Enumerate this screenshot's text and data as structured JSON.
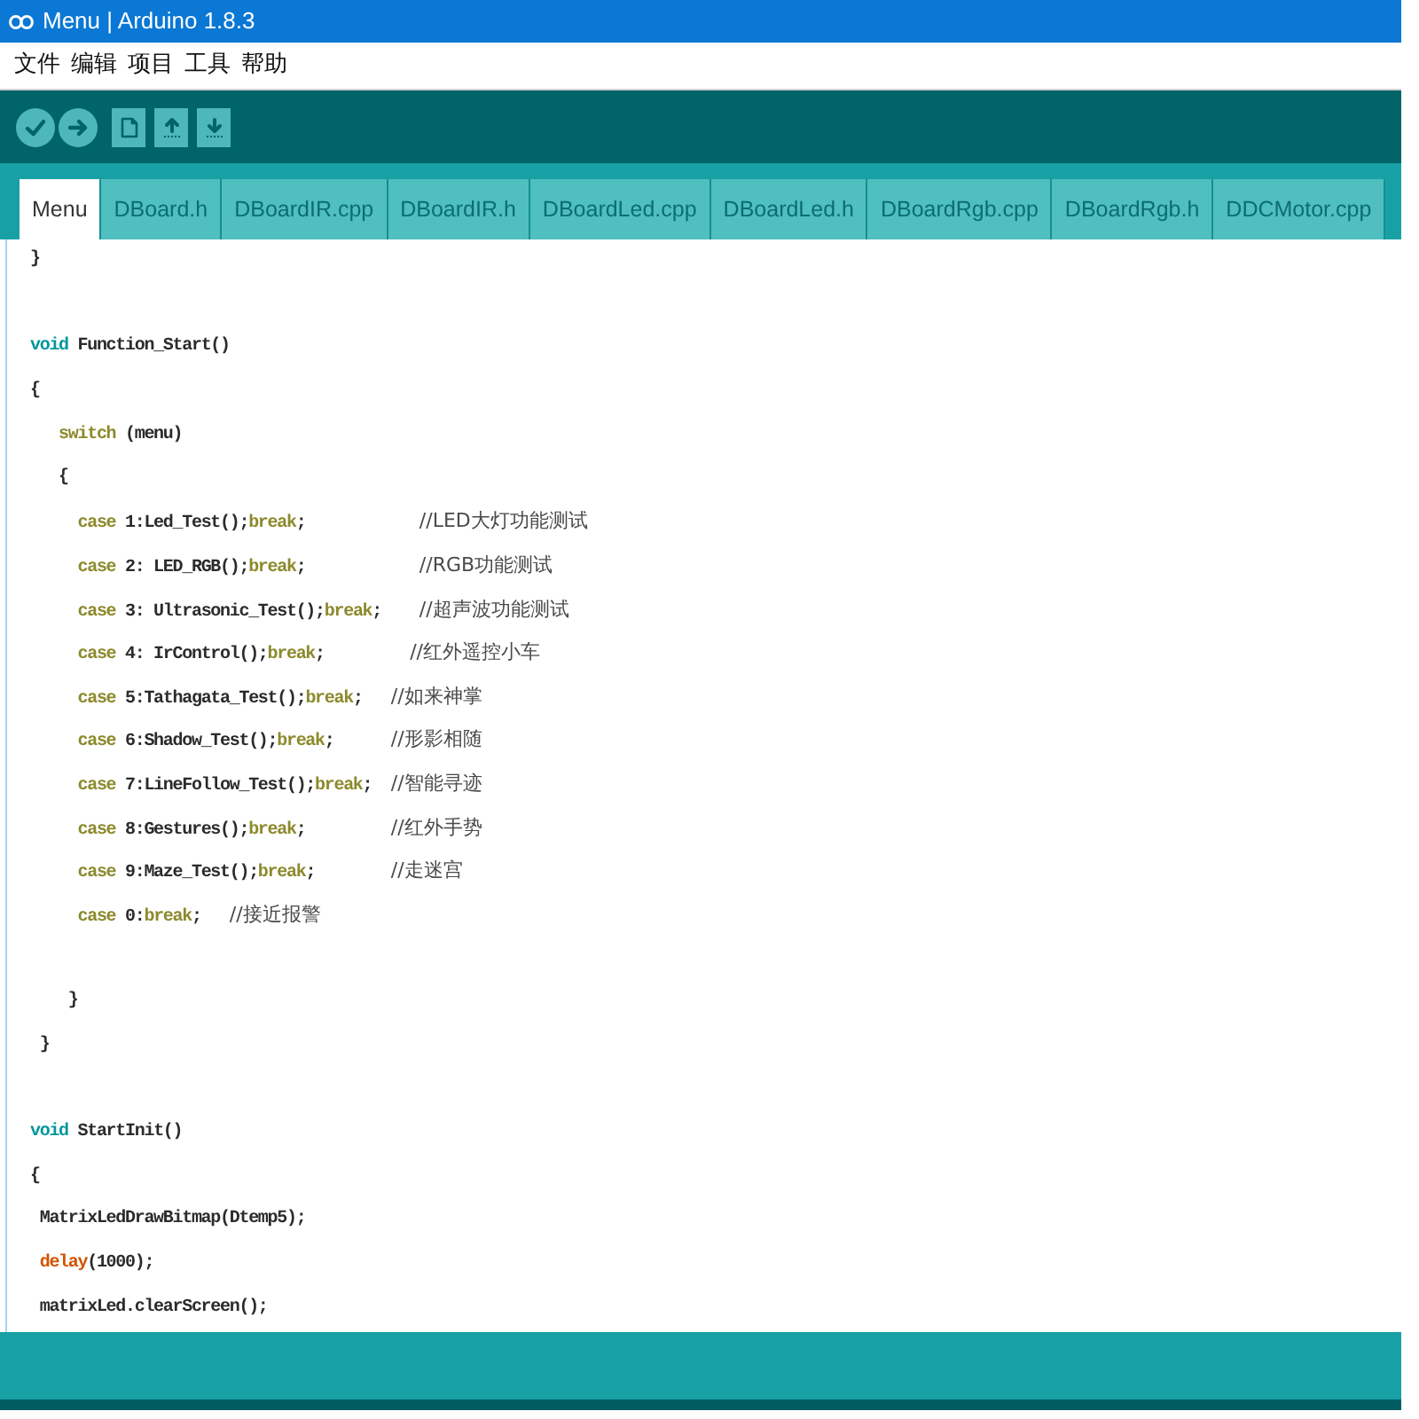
{
  "window": {
    "title": "Menu | Arduino 1.8.3"
  },
  "menu_bar": {
    "items": [
      "文件",
      "编辑",
      "项目",
      "工具",
      "帮助"
    ]
  },
  "tabs": [
    {
      "label": "Menu",
      "selected": true
    },
    {
      "label": "DBoard.h",
      "selected": false
    },
    {
      "label": "DBoardIR.cpp",
      "selected": false
    },
    {
      "label": "DBoardIR.h",
      "selected": false
    },
    {
      "label": "DBoardLed.cpp",
      "selected": false
    },
    {
      "label": "DBoardLed.h",
      "selected": false
    },
    {
      "label": "DBoardRgb.cpp",
      "selected": false
    },
    {
      "label": "DBoardRgb.h",
      "selected": false
    },
    {
      "label": "DDCMotor.cpp",
      "selected": false
    }
  ],
  "editor": {
    "lines": [
      {
        "kind": "code",
        "tokens": [
          {
            "kind": "plain",
            "text": "}"
          }
        ]
      },
      {
        "kind": "blank"
      },
      {
        "kind": "code",
        "tokens": [
          {
            "kind": "type",
            "text": "void"
          },
          {
            "kind": "plain",
            "text": " Function_Start()"
          }
        ]
      },
      {
        "kind": "code",
        "tokens": [
          {
            "kind": "plain",
            "text": "{"
          }
        ]
      },
      {
        "kind": "code",
        "tokens": [
          {
            "kind": "keyword",
            "text": "   switch"
          },
          {
            "kind": "plain",
            "text": " (menu)"
          }
        ]
      },
      {
        "kind": "code",
        "tokens": [
          {
            "kind": "plain",
            "text": "   {"
          }
        ]
      },
      {
        "kind": "code",
        "tokens": [
          {
            "kind": "keyword",
            "text": "     case"
          },
          {
            "kind": "plain",
            "text": " 1:Led_Test();"
          },
          {
            "kind": "keyword",
            "text": "break"
          },
          {
            "kind": "plain",
            "text": ";            "
          },
          {
            "kind": "comment",
            "text": "//LED大灯功能测试"
          }
        ]
      },
      {
        "kind": "code",
        "tokens": [
          {
            "kind": "keyword",
            "text": "     case"
          },
          {
            "kind": "plain",
            "text": " 2: LED_RGB();"
          },
          {
            "kind": "keyword",
            "text": "break"
          },
          {
            "kind": "plain",
            "text": ";            "
          },
          {
            "kind": "comment",
            "text": "//RGB功能测试"
          }
        ]
      },
      {
        "kind": "code",
        "tokens": [
          {
            "kind": "keyword",
            "text": "     case"
          },
          {
            "kind": "plain",
            "text": " 3: Ultrasonic_Test();"
          },
          {
            "kind": "keyword",
            "text": "break"
          },
          {
            "kind": "plain",
            "text": ";    "
          },
          {
            "kind": "comment",
            "text": "//超声波功能测试"
          }
        ]
      },
      {
        "kind": "code",
        "tokens": [
          {
            "kind": "keyword",
            "text": "     case"
          },
          {
            "kind": "plain",
            "text": " 4: IrControl();"
          },
          {
            "kind": "keyword",
            "text": "break"
          },
          {
            "kind": "plain",
            "text": ";         "
          },
          {
            "kind": "comment",
            "text": "//红外遥控小车"
          }
        ]
      },
      {
        "kind": "code",
        "tokens": [
          {
            "kind": "keyword",
            "text": "     case"
          },
          {
            "kind": "plain",
            "text": " 5:Tathagata_Test();"
          },
          {
            "kind": "keyword",
            "text": "break"
          },
          {
            "kind": "plain",
            "text": ";   "
          },
          {
            "kind": "comment",
            "text": "//如来神掌"
          }
        ]
      },
      {
        "kind": "code",
        "tokens": [
          {
            "kind": "keyword",
            "text": "     case"
          },
          {
            "kind": "plain",
            "text": " 6:Shadow_Test();"
          },
          {
            "kind": "keyword",
            "text": "break"
          },
          {
            "kind": "plain",
            "text": ";      "
          },
          {
            "kind": "comment",
            "text": "//形影相随"
          }
        ]
      },
      {
        "kind": "code",
        "tokens": [
          {
            "kind": "keyword",
            "text": "     case"
          },
          {
            "kind": "plain",
            "text": " 7:LineFollow_Test();"
          },
          {
            "kind": "keyword",
            "text": "break"
          },
          {
            "kind": "plain",
            "text": ";  "
          },
          {
            "kind": "comment",
            "text": "//智能寻迹"
          }
        ]
      },
      {
        "kind": "code",
        "tokens": [
          {
            "kind": "keyword",
            "text": "     case"
          },
          {
            "kind": "plain",
            "text": " 8:Gestures();"
          },
          {
            "kind": "keyword",
            "text": "break"
          },
          {
            "kind": "plain",
            "text": ";         "
          },
          {
            "kind": "comment",
            "text": "//红外手势"
          }
        ]
      },
      {
        "kind": "code",
        "tokens": [
          {
            "kind": "keyword",
            "text": "     case"
          },
          {
            "kind": "plain",
            "text": " 9:Maze_Test();"
          },
          {
            "kind": "keyword",
            "text": "break"
          },
          {
            "kind": "plain",
            "text": ";        "
          },
          {
            "kind": "comment",
            "text": "//走迷宫"
          }
        ]
      },
      {
        "kind": "code",
        "tokens": [
          {
            "kind": "keyword",
            "text": "     case"
          },
          {
            "kind": "plain",
            "text": " 0:"
          },
          {
            "kind": "keyword",
            "text": "break"
          },
          {
            "kind": "plain",
            "text": ";   "
          },
          {
            "kind": "comment",
            "text": "//接近报警"
          }
        ]
      },
      {
        "kind": "blank"
      },
      {
        "kind": "code",
        "tokens": [
          {
            "kind": "plain",
            "text": "    }"
          }
        ]
      },
      {
        "kind": "code",
        "tokens": [
          {
            "kind": "plain",
            "text": " }"
          }
        ]
      },
      {
        "kind": "blank"
      },
      {
        "kind": "code",
        "tokens": [
          {
            "kind": "type",
            "text": "void"
          },
          {
            "kind": "plain",
            "text": " StartInit()"
          }
        ]
      },
      {
        "kind": "code",
        "tokens": [
          {
            "kind": "plain",
            "text": "{"
          }
        ]
      },
      {
        "kind": "code",
        "tokens": [
          {
            "kind": "plain",
            "text": " MatrixLedDrawBitmap(Dtemp5);"
          }
        ]
      },
      {
        "kind": "code",
        "tokens": [
          {
            "kind": "function",
            "text": " delay"
          },
          {
            "kind": "plain",
            "text": "(1000);"
          }
        ]
      },
      {
        "kind": "code",
        "tokens": [
          {
            "kind": "plain",
            "text": " matrixLed.clearScreen();"
          }
        ]
      }
    ]
  }
}
